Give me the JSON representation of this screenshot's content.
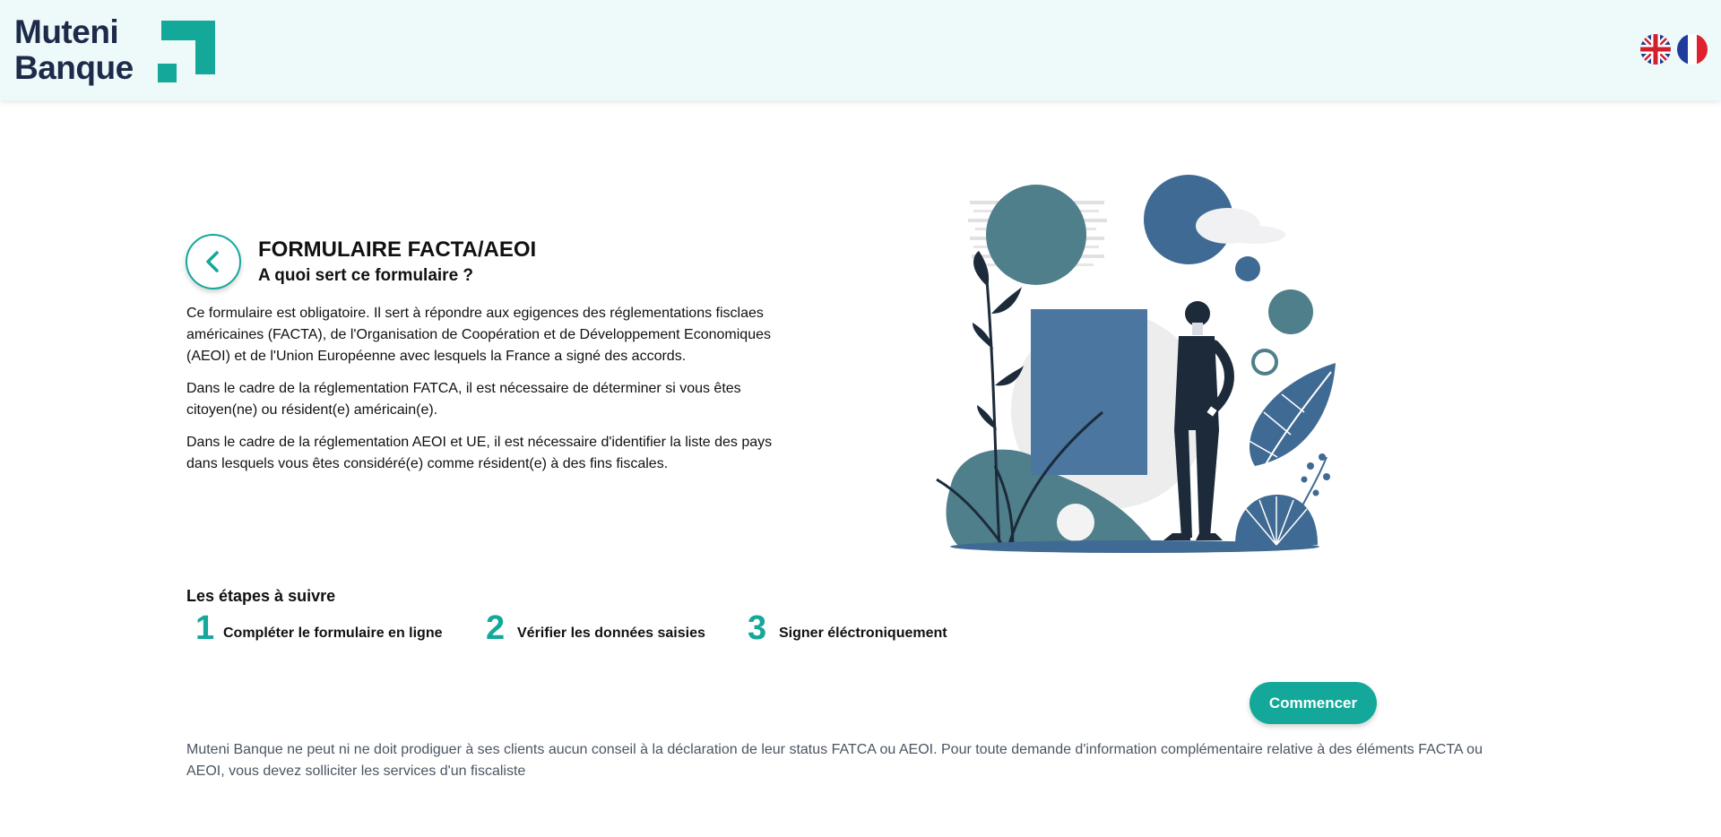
{
  "brand": {
    "line1": "Muteni",
    "line2": "Banque",
    "accent_color": "#14a89a",
    "text_color": "#1e2a4a"
  },
  "header": {
    "languages": [
      {
        "code": "en",
        "icon": "uk-flag-icon"
      },
      {
        "code": "fr",
        "icon": "france-flag-icon"
      }
    ]
  },
  "intro": {
    "back_icon": "chevron-left-icon",
    "title": "FORMULAIRE FACTA/AEOI",
    "subtitle": "A quoi sert ce formulaire ?",
    "paragraphs": [
      "Ce formulaire est obligatoire. Il sert à répondre aux egigences des réglementations fisclaes américaines (FACTA), de l'Organisation de Coopération et de Développement Economiques (AEOI) et de l'Union Européenne avec lesquels la France a signé des accords.",
      "Dans le cadre de la réglementation FATCA, il est nécessaire de déterminer si vous êtes citoyen(ne) ou résident(e) américain(e).",
      "Dans le cadre de la réglementation AEOI et UE, il est nécessaire d'identifier la liste des pays dans lesquels vous êtes considéré(e) comme résident(e) à des fins fiscales."
    ]
  },
  "steps": {
    "title": "Les étapes à suivre",
    "items": [
      {
        "number": "1",
        "label": "Compléter le formulaire en ligne"
      },
      {
        "number": "2",
        "label": "Vérifier les données saisies"
      },
      {
        "number": "3",
        "label": "Signer éléctroniquement"
      }
    ]
  },
  "actions": {
    "start_label": "Commencer"
  },
  "disclaimer": "Muteni Banque ne peut ni ne doit prodiguer à ses clients aucun conseil à la déclaration de leur status FATCA ou AEOI. Pour toute demande d'information complémentaire relative à des éléments FACTA ou AEOI, vous devez solliciter les services d'un fiscaliste"
}
